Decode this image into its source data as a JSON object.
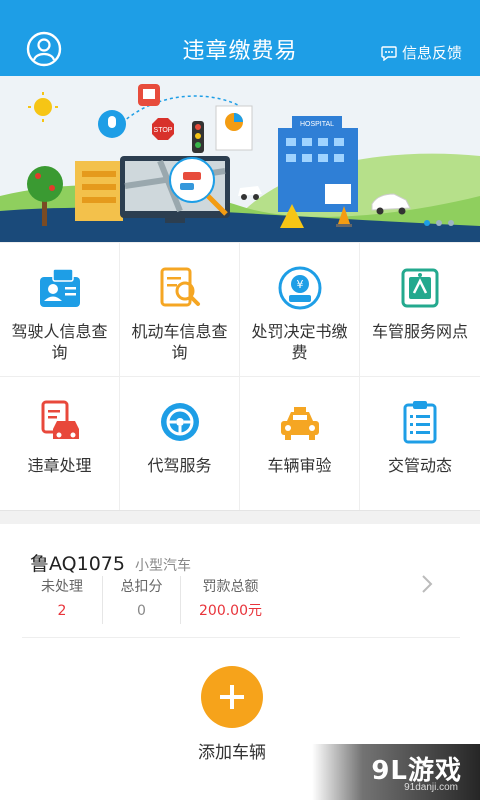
{
  "header": {
    "title": "违章缴费易",
    "feedback_label": "信息反馈"
  },
  "banner": {
    "stop_sign_text": "STOP",
    "hospital_text": "HOSPITAL",
    "page_count": 3,
    "active_page": 1
  },
  "grid": {
    "items": [
      {
        "label": "驾驶人信息查询",
        "icon": "driver-card-icon"
      },
      {
        "label": "机动车信息查询",
        "icon": "vehicle-search-icon"
      },
      {
        "label": "处罚决定书缴费",
        "icon": "payment-ticket-icon"
      },
      {
        "label": "车管服务网点",
        "icon": "service-point-icon"
      },
      {
        "label": "违章处理",
        "icon": "violation-car-icon"
      },
      {
        "label": "代驾服务",
        "icon": "steering-wheel-icon"
      },
      {
        "label": "车辆审验",
        "icon": "taxi-icon"
      },
      {
        "label": "交管动态",
        "icon": "clipboard-icon"
      }
    ]
  },
  "vehicle": {
    "plate": "鲁AQ1075",
    "type": "小型汽车",
    "stats": [
      {
        "label": "未处理",
        "value": "2"
      },
      {
        "label": "总扣分",
        "value": "0"
      },
      {
        "label": "罚款总额",
        "value": "200.00元"
      }
    ]
  },
  "add_vehicle": {
    "label": "添加车辆"
  },
  "watermark": {
    "main": "9L游戏",
    "sub": "91danji.com"
  },
  "colors": {
    "primary": "#1e9ee6",
    "accent_orange": "#f6a31b",
    "alert_red": "#e8343b"
  }
}
